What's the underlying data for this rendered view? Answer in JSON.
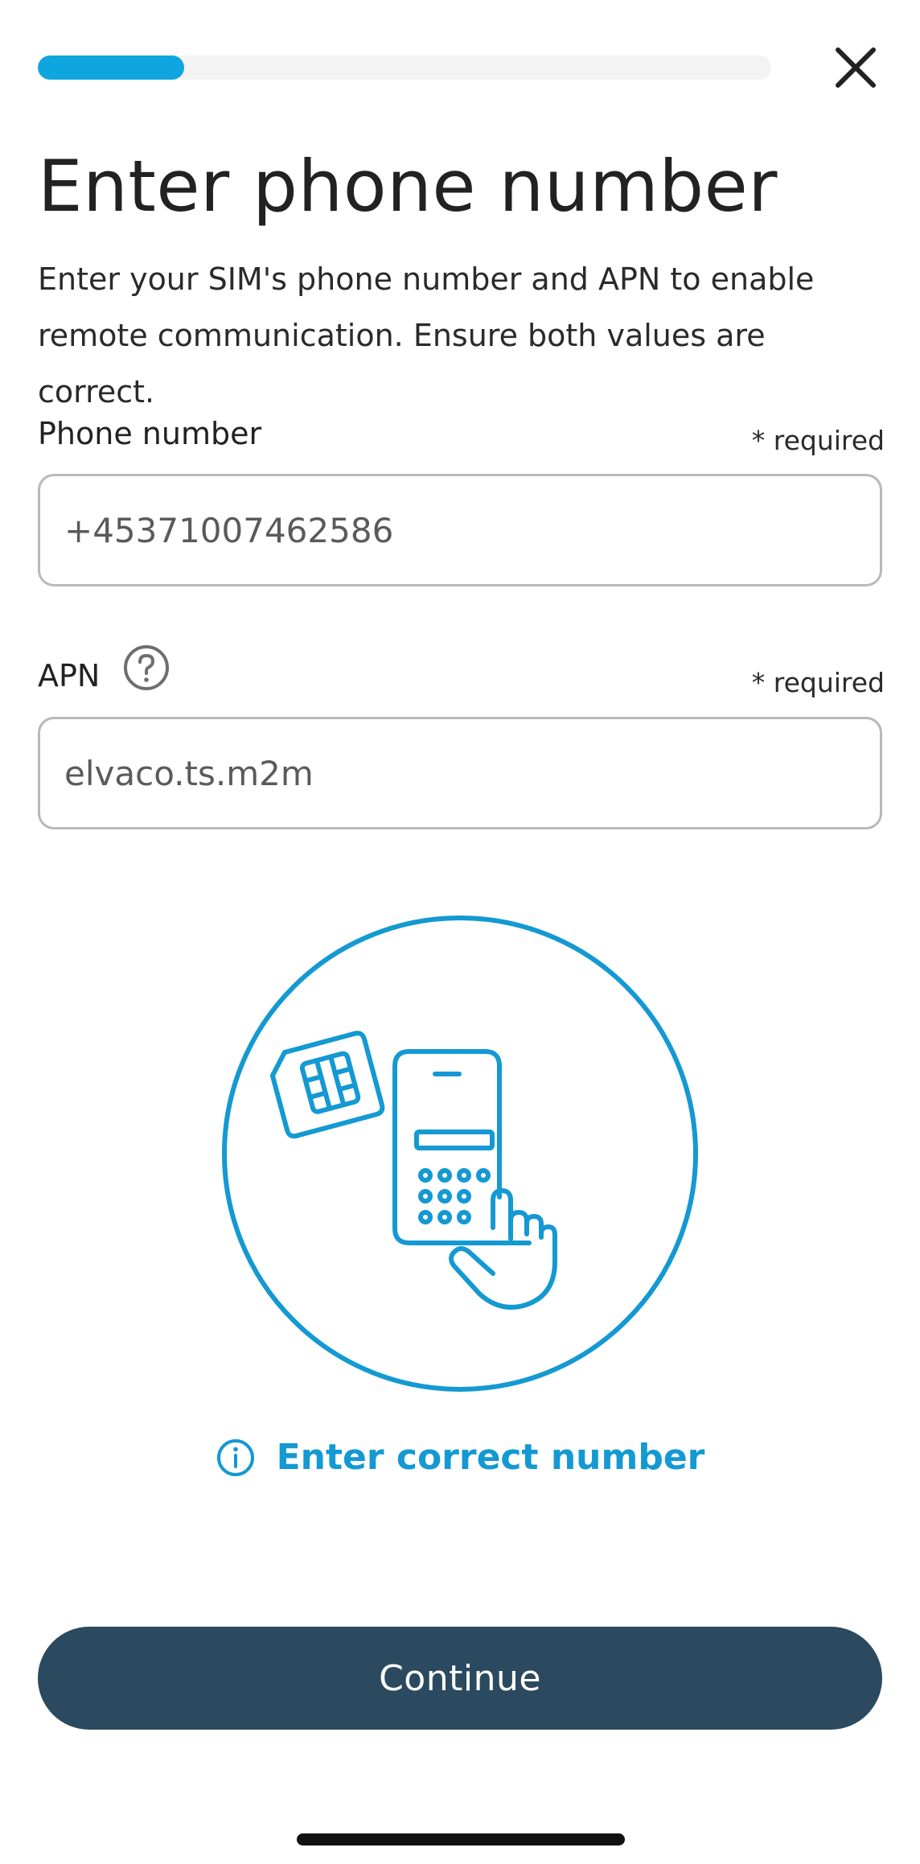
{
  "progress": {
    "fraction": 0.2,
    "color": "#0fa5df",
    "track_color": "#f3f3f3"
  },
  "header": {
    "close_icon": "close-icon",
    "title": "Enter phone number",
    "description": "Enter your SIM's phone number and APN to enable remote communication. Ensure both values are correct."
  },
  "form": {
    "phone": {
      "label": "Phone number",
      "required": "* required",
      "value": "+45371007462586"
    },
    "apn": {
      "label": "APN",
      "help_icon": "question-circle-icon",
      "required": "* required",
      "value": "elvaco.ts.m2m"
    }
  },
  "illustration": {
    "icon": "sim-card-keypad-illustration",
    "color": "#1499d2"
  },
  "hint": {
    "icon": "info-icon",
    "text": "Enter correct number",
    "color": "#1499d2"
  },
  "footer": {
    "continue_label": "Continue",
    "button_color": "#2b4a5f"
  }
}
